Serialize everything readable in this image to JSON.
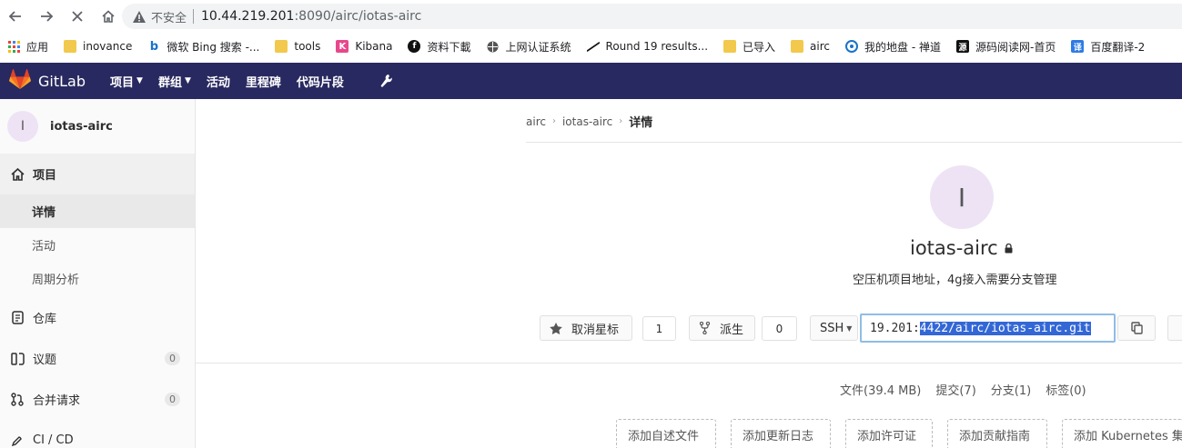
{
  "browser": {
    "insecure_label": "不安全",
    "url_host": "10.44.219.201",
    "url_rest": ":8090/airc/iotas-airc"
  },
  "bookmarks": [
    {
      "label": "应用",
      "icon": "apps-grid-icon"
    },
    {
      "label": "inovance",
      "icon": "folder-icon"
    },
    {
      "label": "微软 Bing 搜索 -...",
      "icon": "bing-icon"
    },
    {
      "label": "tools",
      "icon": "folder-icon"
    },
    {
      "label": "Kibana",
      "icon": "kibana-icon"
    },
    {
      "label": "资料下載",
      "icon": "link-icon"
    },
    {
      "label": "上网认证系统",
      "icon": "globe-icon"
    },
    {
      "label": "Round 19 results...",
      "icon": "benchmark-icon"
    },
    {
      "label": "已导入",
      "icon": "folder-icon"
    },
    {
      "label": "airc",
      "icon": "folder-icon"
    },
    {
      "label": "我的地盘 - 禅道",
      "icon": "zentao-icon"
    },
    {
      "label": "源码阅读网-首页",
      "icon": "source-icon"
    },
    {
      "label": "百度翻译-2",
      "icon": "translate-icon"
    }
  ],
  "gitlab": {
    "logo_text": "GitLab",
    "menu": [
      "项目",
      "群组",
      "活动",
      "里程碑",
      "代码片段"
    ]
  },
  "sidebar": {
    "avatar_letter": "I",
    "project_name": "iotas-airc",
    "section_label": "项目",
    "sub_items": [
      "详情",
      "活动",
      "周期分析"
    ],
    "repo_label": "仓库",
    "issues_label": "议题",
    "issues_count": "0",
    "mr_label": "合并请求",
    "mr_count": "0",
    "ci_label": "CI / CD"
  },
  "breadcrumb": [
    "airc",
    "iotas-airc",
    "详情"
  ],
  "project": {
    "avatar_letter": "I",
    "title": "iotas-airc",
    "description": "空压机项目地址，4g接入需要分支管理",
    "star_label": "取消星标",
    "star_count": "1",
    "fork_label": "派生",
    "fork_count": "0",
    "clone_type": "SSH",
    "clone_url_prefix": "19.201:",
    "clone_url_selected": "4422/airc/iotas-airc.git"
  },
  "stats": {
    "files": "文件(39.4 MB)",
    "commits": "提交(7)",
    "branches": "分支(1)",
    "tags": "标签(0)"
  },
  "quick_actions": [
    "添加自述文件",
    "添加更新日志",
    "添加许可证",
    "添加贡献指南",
    "添加 Kubernetes 集"
  ]
}
